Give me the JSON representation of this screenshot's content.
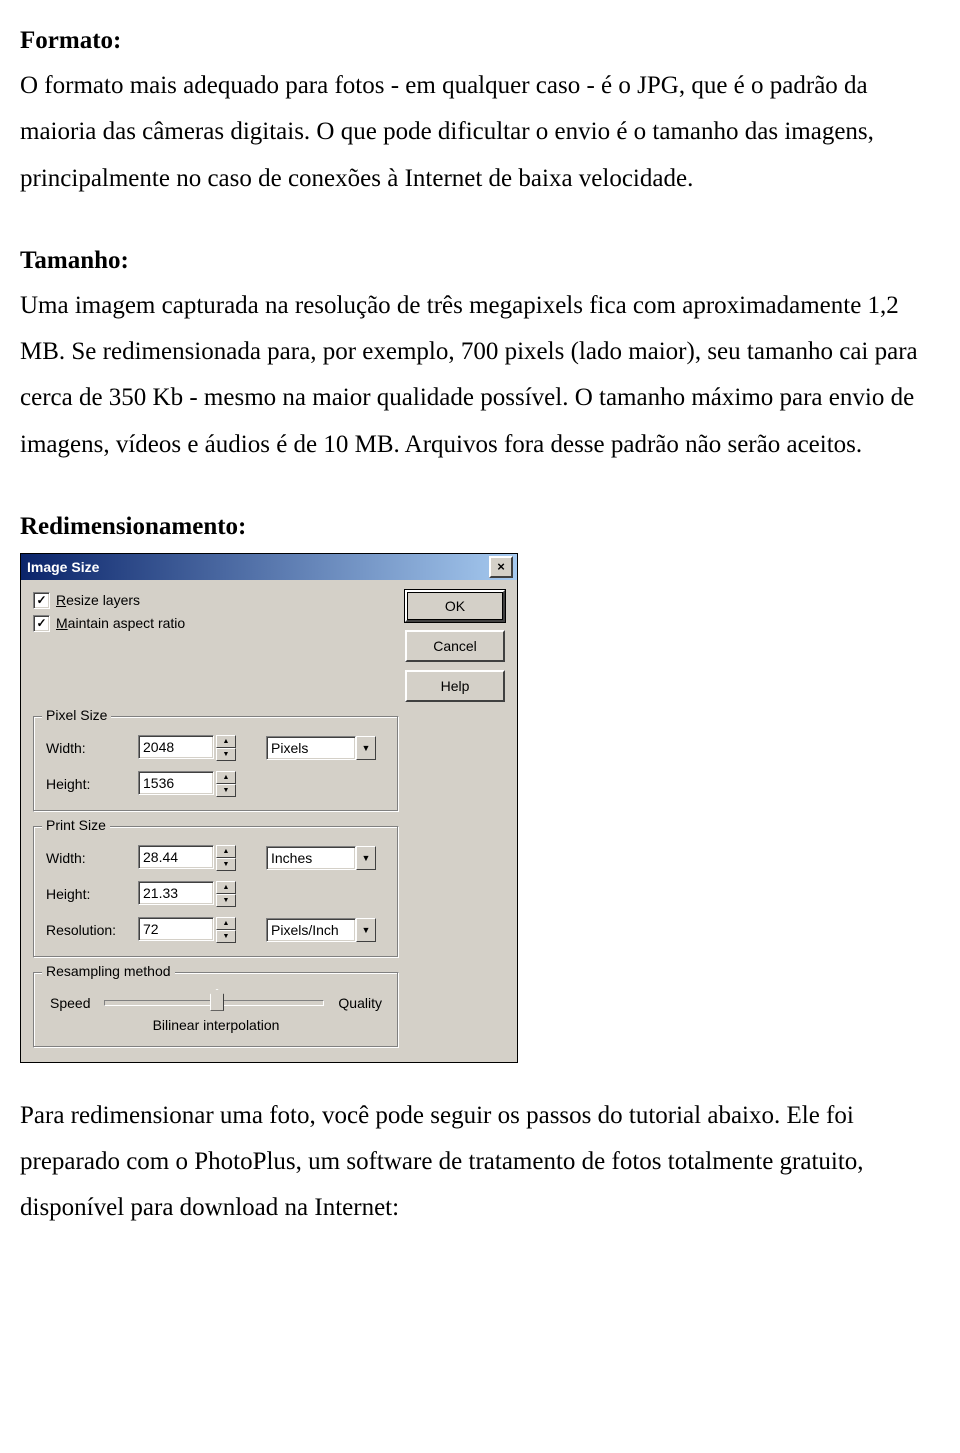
{
  "sections": {
    "formato": {
      "title": "Formato:",
      "body": "O formato mais adequado para fotos - em qualquer caso - é o JPG, que é o padrão da maioria das câmeras digitais. O que pode dificultar o envio é o tamanho das imagens, principalmente no caso de conexões à Internet de baixa velocidade."
    },
    "tamanho": {
      "title": "Tamanho:",
      "body": "Uma imagem capturada na resolução de três megapixels fica com aproximadamente 1,2 MB. Se redimensionada para, por exemplo, 700 pixels (lado maior), seu tamanho cai para cerca de 350 Kb - mesmo na maior qualidade possível. O tamanho máximo para envio de imagens, vídeos e áudios é de 10 MB. Arquivos fora desse padrão não serão aceitos."
    },
    "redim": {
      "title": "Redimensionamento:"
    },
    "footer": "Para redimensionar uma foto, você pode seguir os passos do tutorial abaixo. Ele foi preparado com o PhotoPlus, um software de tratamento de fotos totalmente gratuito, disponível para download na Internet:"
  },
  "dialog": {
    "title": "Image Size",
    "close_glyph": "×",
    "checkboxes": {
      "resize_layers": "Resize layers",
      "maintain_aspect": "Maintain aspect ratio",
      "check_glyph": "✓"
    },
    "buttons": {
      "ok": "OK",
      "cancel": "Cancel",
      "help": "Help"
    },
    "pixel_group": {
      "legend": "Pixel Size",
      "width_label": "Width:",
      "width_value": "2048",
      "height_label": "Height:",
      "height_value": "1536",
      "unit": "Pixels"
    },
    "print_group": {
      "legend": "Print Size",
      "width_label": "Width:",
      "width_value": "28.44",
      "height_label": "Height:",
      "height_value": "21.33",
      "unit": "Inches",
      "res_label": "Resolution:",
      "res_value": "72",
      "res_unit": "Pixels/Inch"
    },
    "resample_group": {
      "legend": "Resampling method",
      "left": "Speed",
      "right": "Quality",
      "caption": "Bilinear interpolation"
    },
    "arrows": {
      "up": "▲",
      "down": "▼"
    }
  }
}
